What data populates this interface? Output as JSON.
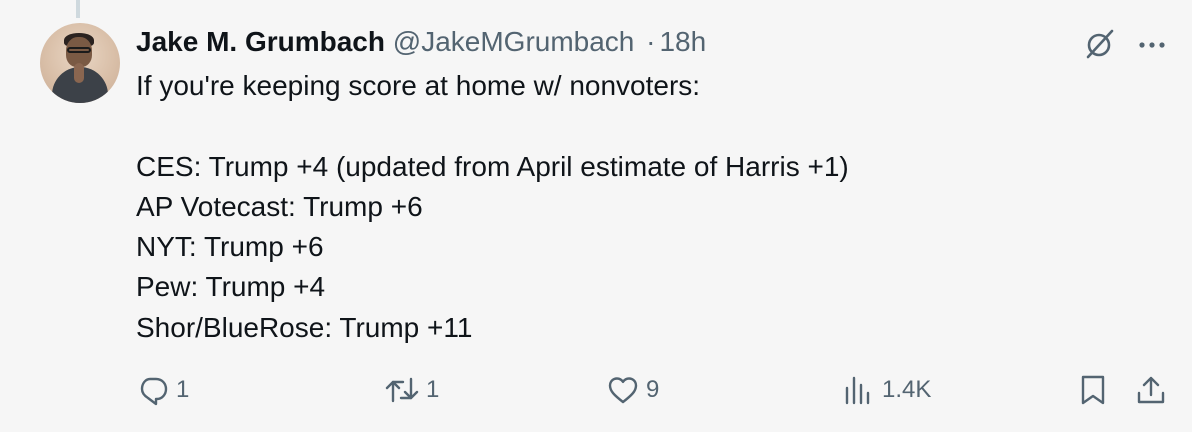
{
  "tweet": {
    "author_name": "Jake M. Grumbach",
    "author_handle": "@JakeMGrumbach",
    "separator": "·",
    "time": "18h",
    "lines": [
      "If you're keeping score at home w/ nonvoters:",
      "",
      "CES: Trump +4 (updated from April estimate of Harris +1)",
      "AP Votecast: Trump +6",
      "NYT: Trump +6",
      "Pew: Trump +4",
      "Shor/BlueRose: Trump +11"
    ]
  },
  "actions": {
    "replies": "1",
    "reposts": "1",
    "likes": "9",
    "views": "1.4K"
  },
  "icons": {
    "reply": "reply-icon",
    "repost": "repost-icon",
    "like": "heart-icon",
    "views": "views-icon",
    "bookmark": "bookmark-icon",
    "share": "share-icon",
    "grok": "grok-icon",
    "more": "more-icon"
  },
  "colors": {
    "background": "#f6f6f6",
    "text": "#0f1419",
    "secondary": "#536471"
  }
}
